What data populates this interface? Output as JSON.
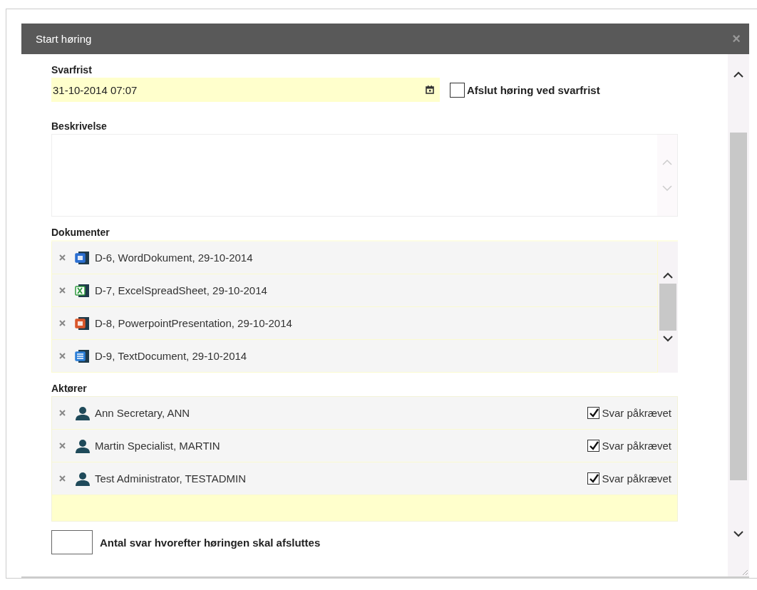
{
  "dialog": {
    "title": "Start høring",
    "close": "×"
  },
  "deadline": {
    "label": "Svarfrist",
    "value": "31-10-2014 07:07",
    "close_at_deadline": {
      "label": "Afslut høring ved svarfrist",
      "checked": false
    }
  },
  "description": {
    "label": "Beskrivelse"
  },
  "documents": {
    "label": "Dokumenter",
    "items": [
      {
        "kind": "word",
        "text": "D-6, WordDokument, 29-10-2014"
      },
      {
        "kind": "excel",
        "text": "D-7, ExcelSpreadSheet, 29-10-2014"
      },
      {
        "kind": "powerpoint",
        "text": "D-8, PowerpointPresentation, 29-10-2014"
      },
      {
        "kind": "text",
        "text": "D-9, TextDocument, 29-10-2014"
      }
    ]
  },
  "actors": {
    "label": "Aktører",
    "items": [
      {
        "name": "Ann Secretary, ANN",
        "answer_required": {
          "label": "Svar påkrævet",
          "checked": true
        }
      },
      {
        "name": "Martin Specialist, MARTIN",
        "answer_required": {
          "label": "Svar påkrævet",
          "checked": true
        }
      },
      {
        "name": "Test Administrator, TESTADMIN",
        "answer_required": {
          "label": "Svar påkrævet",
          "checked": true
        }
      }
    ]
  },
  "answer_count": {
    "label": "Antal svar hvorefter høringen skal afsluttes"
  }
}
